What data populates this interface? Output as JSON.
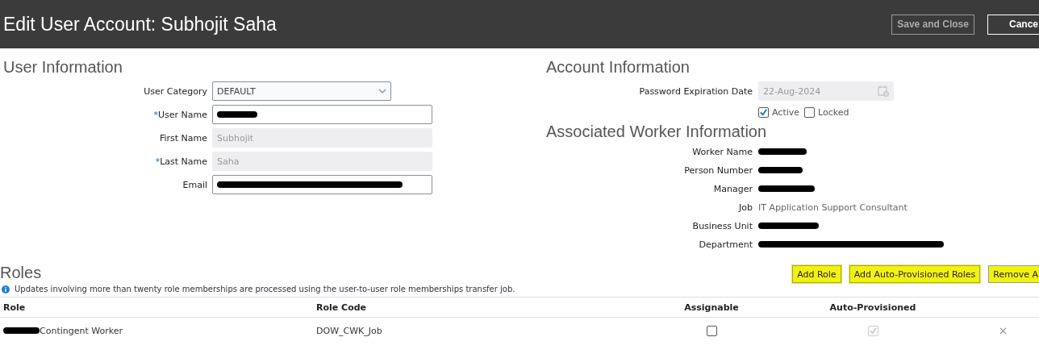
{
  "header": {
    "title": "Edit User Account: Subhojit Saha",
    "buttons": [
      {
        "label": "Save and Close",
        "disabled": true
      },
      {
        "label": "Cance",
        "disabled": false
      }
    ]
  },
  "user_information": {
    "heading": "User Information",
    "fields": [
      {
        "label": "User Category",
        "kind": "select",
        "value": "DEFAULT",
        "readonly": false
      },
      {
        "label": "User Name",
        "marker": "*",
        "kind": "text",
        "readonly": false,
        "redacted": true
      },
      {
        "label": "First Name",
        "kind": "text",
        "value": "Subhojit",
        "readonly": true
      },
      {
        "label": "Last Name",
        "marker": "*",
        "kind": "text",
        "value": "Saha",
        "readonly": true
      },
      {
        "label": "Email",
        "kind": "text",
        "readonly": false,
        "redacted": true
      }
    ]
  },
  "account_information": {
    "heading": "Account Information",
    "password_expiration": {
      "label": "Password Expiration Date",
      "value": "22-Aug-2024"
    },
    "checkboxes": [
      {
        "label": "Active",
        "checked": true
      },
      {
        "label": "Locked",
        "checked": false
      }
    ]
  },
  "associated_worker": {
    "heading": "Associated Worker Information",
    "fields": [
      {
        "label": "Worker Name",
        "redacted": true
      },
      {
        "label": "Person Number",
        "redacted": true
      },
      {
        "label": "Manager",
        "redacted": true
      },
      {
        "label": "Job",
        "value": "IT Application Support Consultant"
      },
      {
        "label": "Business Unit",
        "redacted": true
      },
      {
        "label": "Department",
        "redacted": true
      }
    ]
  },
  "roles": {
    "heading": "Roles",
    "buttons": [
      "Add Role",
      "Add Auto-Provisioned Roles",
      "Remove A"
    ],
    "info": "Updates involving more than twenty role memberships are processed using the user-to-user role memberships transfer job.",
    "columns": [
      "Role",
      "Role Code",
      "Assignable",
      "Auto-Provisioned"
    ],
    "rows": [
      {
        "role": "Contingent Worker",
        "role_redacted": true,
        "role_code": "DOW_CWK_Job",
        "assignable": false,
        "auto_provisioned": true
      }
    ]
  }
}
